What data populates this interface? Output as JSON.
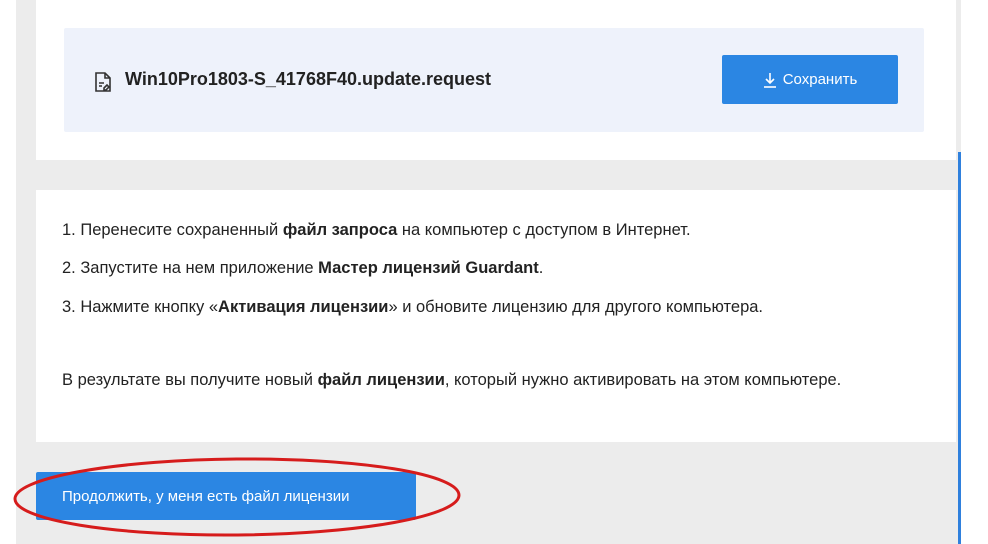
{
  "file_panel": {
    "file_name": "Win10Pro1803-S_41768F40.update.request",
    "save_label": "Сохранить",
    "file_icon": "file-icon",
    "save_icon": "download-icon"
  },
  "instructions": {
    "step1": {
      "prefix": "1. Перенесите сохраненный ",
      "bold": "файл запроса",
      "suffix": " на компьютер с доступом в Интернет."
    },
    "step2": {
      "prefix": "2. Запустите на нем приложение ",
      "bold": "Мастер лицензий Guardant",
      "suffix": "."
    },
    "step3": {
      "prefix": "3. Нажмите кнопку «",
      "bold": "Активация лицензии",
      "suffix": "» и обновите лицензию для другого компьютера."
    },
    "result": {
      "prefix": "В результате вы получите новый ",
      "bold": "файл лицензии",
      "suffix": ", который нужно активировать на этом компьютере."
    }
  },
  "continue_label": "Продолжить, у меня есть файл лицензии",
  "colors": {
    "accent": "#2b86e3",
    "annotation": "#d61c1c",
    "panel": "#eef2fb"
  }
}
